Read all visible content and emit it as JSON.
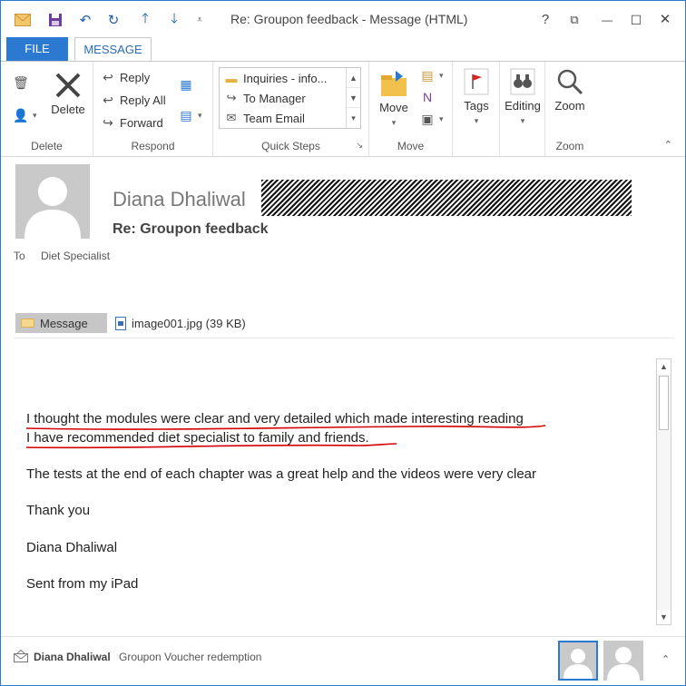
{
  "window": {
    "title": "Re: Groupon feedback - Message (HTML)",
    "help": "?",
    "restore": "⧉",
    "minimize": "—",
    "maximize": "☐",
    "close": "✕"
  },
  "tabs": {
    "file": "FILE",
    "message": "MESSAGE"
  },
  "ribbon": {
    "delete_group": {
      "delete_label": "Delete",
      "group_label": "Delete"
    },
    "respond_group": {
      "reply": "Reply",
      "reply_all": "Reply All",
      "forward": "Forward",
      "group_label": "Respond"
    },
    "quick_steps": {
      "items": [
        "Inquiries - info...",
        "To Manager",
        "Team Email"
      ],
      "group_label": "Quick Steps"
    },
    "move_group": {
      "move_label": "Move",
      "group_label": "Move"
    },
    "tags": {
      "label": "Tags"
    },
    "editing": {
      "label": "Editing"
    },
    "zoom_group": {
      "zoom_label": "Zoom",
      "group_label": "Zoom"
    }
  },
  "header": {
    "sender": "Diana Dhaliwal",
    "subject": "Re: Groupon feedback",
    "to_label": "To",
    "to_value": "Diet Specialist"
  },
  "attachments": {
    "message_tab": "Message",
    "file": "image001.jpg (39 KB)"
  },
  "body": {
    "lines": [
      "I thought the modules were clear and very detailed which made interesting reading",
      "I have recommended diet specialist to family and friends.",
      "The tests at the end of each chapter was a great help and the videos were very clear",
      "Thank you",
      "Diana Dhaliwal",
      "Sent from my iPad"
    ]
  },
  "people_pane": {
    "name": "Diana Dhaliwal",
    "subtitle": "Groupon Voucher redemption"
  },
  "colors": {
    "accent": "#2b79d0",
    "underline": "#d40000",
    "avatar": "#c9c9c9"
  }
}
